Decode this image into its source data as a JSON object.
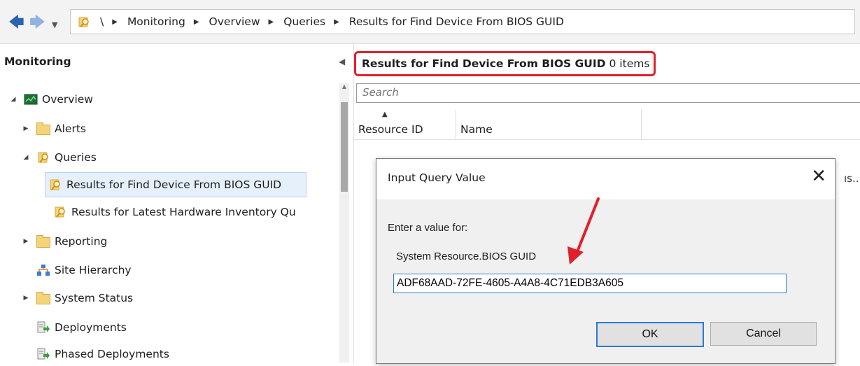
{
  "breadcrumb": {
    "items": [
      "\\",
      "Monitoring",
      "Overview",
      "Queries",
      "Results for Find Device From BIOS GUID"
    ]
  },
  "left_nav": {
    "header": "Monitoring",
    "items": [
      {
        "label": "Overview",
        "icon": "overview-icon"
      },
      {
        "label": "Alerts",
        "icon": "folder-icon"
      },
      {
        "label": "Queries",
        "icon": "query-icon"
      },
      {
        "label": "Results for Find Device From BIOS GUID",
        "icon": "query-icon"
      },
      {
        "label": "Results for Latest Hardware Inventory Qu",
        "icon": "query-icon"
      },
      {
        "label": "Reporting",
        "icon": "folder-icon"
      },
      {
        "label": "Site Hierarchy",
        "icon": "site-hierarchy-icon"
      },
      {
        "label": "System Status",
        "icon": "folder-icon"
      },
      {
        "label": "Deployments",
        "icon": "deployment-icon"
      },
      {
        "label": "Phased Deployments",
        "icon": "deployment-icon"
      }
    ]
  },
  "results": {
    "title": "Results for Find Device From BIOS GUID",
    "count": "0 items",
    "search_placeholder": "Search",
    "columns": [
      "Resource ID",
      "Name"
    ],
    "truncated_text": "ıs..."
  },
  "dialog": {
    "title": "Input Query Value",
    "prompt": "Enter a value for:",
    "field_label": "System Resource.BIOS GUID",
    "field_value": "ADF68AAD-72FE-4605-A4A8-4C71EDB3A605",
    "ok_label": "OK",
    "cancel_label": "Cancel"
  },
  "colors": {
    "highlight_border": "#e0202a",
    "annotation_arrow": "#e0202a",
    "selected_bg": "#e6f0fb"
  }
}
